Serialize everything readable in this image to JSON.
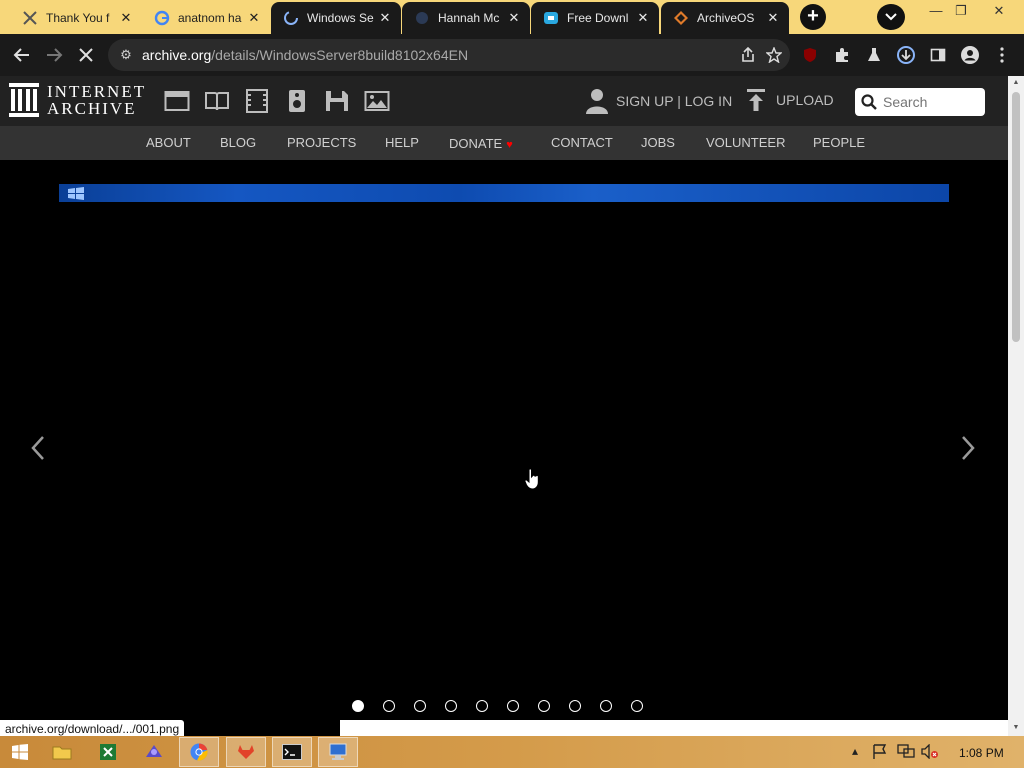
{
  "browser": {
    "tabs": [
      {
        "title": "Thank You f",
        "icon": "archive-tab-icon",
        "active": false
      },
      {
        "title": "anatnom ha",
        "icon": "google-icon",
        "active": false
      },
      {
        "title": "Windows Se",
        "icon": "loading-spinner-icon",
        "active": true
      },
      {
        "title": "Hannah Mc",
        "icon": "site-icon",
        "active": false
      },
      {
        "title": "Free Downl",
        "icon": "download-site-icon",
        "active": false
      },
      {
        "title": "ArchiveOS",
        "icon": "archiveos-icon",
        "active": false
      }
    ],
    "close_glyph": "✕",
    "new_tab_glyph": "+",
    "url_host": "archive.org",
    "url_path": "/details/WindowsServer8build8102x64EN",
    "status_text": "archive.org/download/.../001.png"
  },
  "ia": {
    "logo_line1": "INTERNET",
    "logo_line2": "ARCHIVE",
    "media_icons": [
      "web-icon",
      "texts-icon",
      "video-icon",
      "audio-icon",
      "software-icon",
      "images-icon"
    ],
    "signup_label": "SIGN UP | LOG IN",
    "upload_label": "UPLOAD",
    "search_placeholder": "Search",
    "nav": [
      "ABOUT",
      "BLOG",
      "PROJECTS",
      "HELP",
      "DONATE",
      "CONTACT",
      "JOBS",
      "VOLUNTEER",
      "PEOPLE"
    ],
    "accent": "#ff0000"
  },
  "carousel": {
    "dot_count": 10,
    "active_index": 0,
    "prev_glyph": "‹",
    "next_glyph": "›"
  },
  "taskbar": {
    "clock": "1:08 PM"
  }
}
